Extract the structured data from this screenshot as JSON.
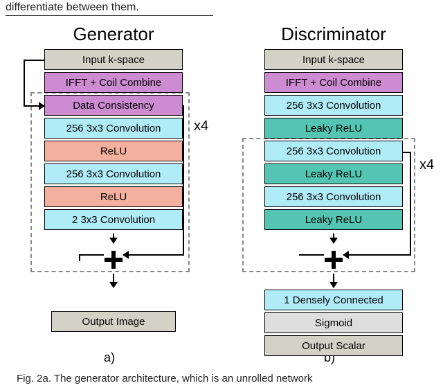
{
  "top_fragment": "differentiate between them.",
  "generator": {
    "title": "Generator",
    "layers": [
      {
        "label": "Input k-space",
        "color": "c-grey"
      },
      {
        "label": "IFFT + Coil Combine",
        "color": "c-purple"
      },
      {
        "label": "Data Consistency",
        "color": "c-purple"
      },
      {
        "label": "256 3x3 Convolution",
        "color": "c-cyan"
      },
      {
        "label": "ReLU",
        "color": "c-orange"
      },
      {
        "label": "256 3x3 Convolution",
        "color": "c-cyan"
      },
      {
        "label": "ReLU",
        "color": "c-orange"
      },
      {
        "label": "2 3x3 Convolution",
        "color": "c-cyan"
      }
    ],
    "repeat_label": "x4",
    "output": {
      "label": "Output Image",
      "color": "c-grey"
    },
    "sublabel": "a)"
  },
  "discriminator": {
    "title": "Discriminator",
    "layers": [
      {
        "label": "Input k-space",
        "color": "c-grey"
      },
      {
        "label": "IFFT + Coil Combine",
        "color": "c-purple"
      },
      {
        "label": "256 3x3 Convolution",
        "color": "c-cyan"
      },
      {
        "label": "Leaky ReLU",
        "color": "c-teal"
      },
      {
        "label": "256 3x3 Convolution",
        "color": "c-cyan"
      },
      {
        "label": "Leaky ReLU",
        "color": "c-teal"
      },
      {
        "label": "256 3x3 Convolution",
        "color": "c-cyan"
      },
      {
        "label": "Leaky ReLU",
        "color": "c-teal"
      }
    ],
    "repeat_label": "x4",
    "tail": [
      {
        "label": "1 Densely Connected",
        "color": "c-cyan"
      },
      {
        "label": "Sigmoid",
        "color": "c-lgrey"
      },
      {
        "label": "Output Scalar",
        "color": "c-grey"
      }
    ],
    "sublabel": "b)"
  },
  "caption": "Fig. 2a. The generator architecture, which is an unrolled network"
}
